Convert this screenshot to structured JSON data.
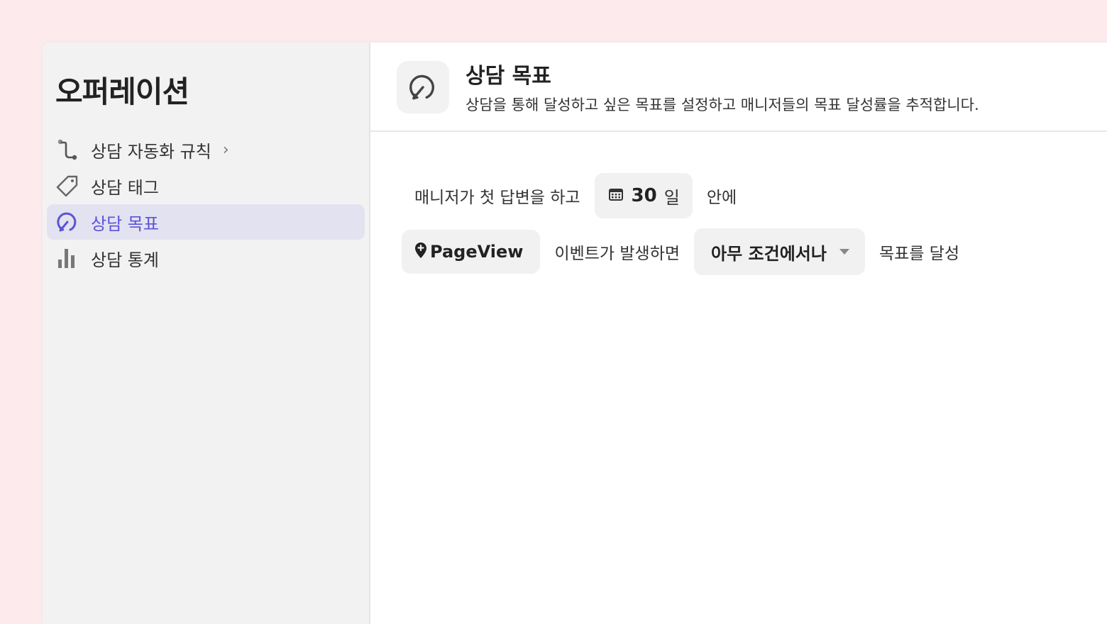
{
  "sidebar": {
    "title": "오퍼레이션",
    "items": [
      {
        "label": "상담 자동화 규칙",
        "icon": "route-icon",
        "chevron": "›"
      },
      {
        "label": "상담 태그",
        "icon": "tag-icon"
      },
      {
        "label": "상담 목표",
        "icon": "goal-icon",
        "active": true
      },
      {
        "label": "상담 통계",
        "icon": "bar-chart-icon"
      }
    ]
  },
  "header": {
    "icon": "goal-icon",
    "title": "상담 목표",
    "description": "상담을 통해 달성하고 싶은 목표를 설정하고 매니저들의 목표 달성률을 추적합니다."
  },
  "rule": {
    "prefix": "매니저가 첫 답변을 하고",
    "days_value": "30",
    "days_unit": "일",
    "within": "안에",
    "event_name": "PageView",
    "event_text": "이벤트가 발생하면",
    "condition": "아무 조건에서나",
    "suffix": "목표를 달성"
  },
  "colors": {
    "background": "#fdeaec",
    "accent": "#5b55d6",
    "active_bg": "#e3e2f0"
  }
}
